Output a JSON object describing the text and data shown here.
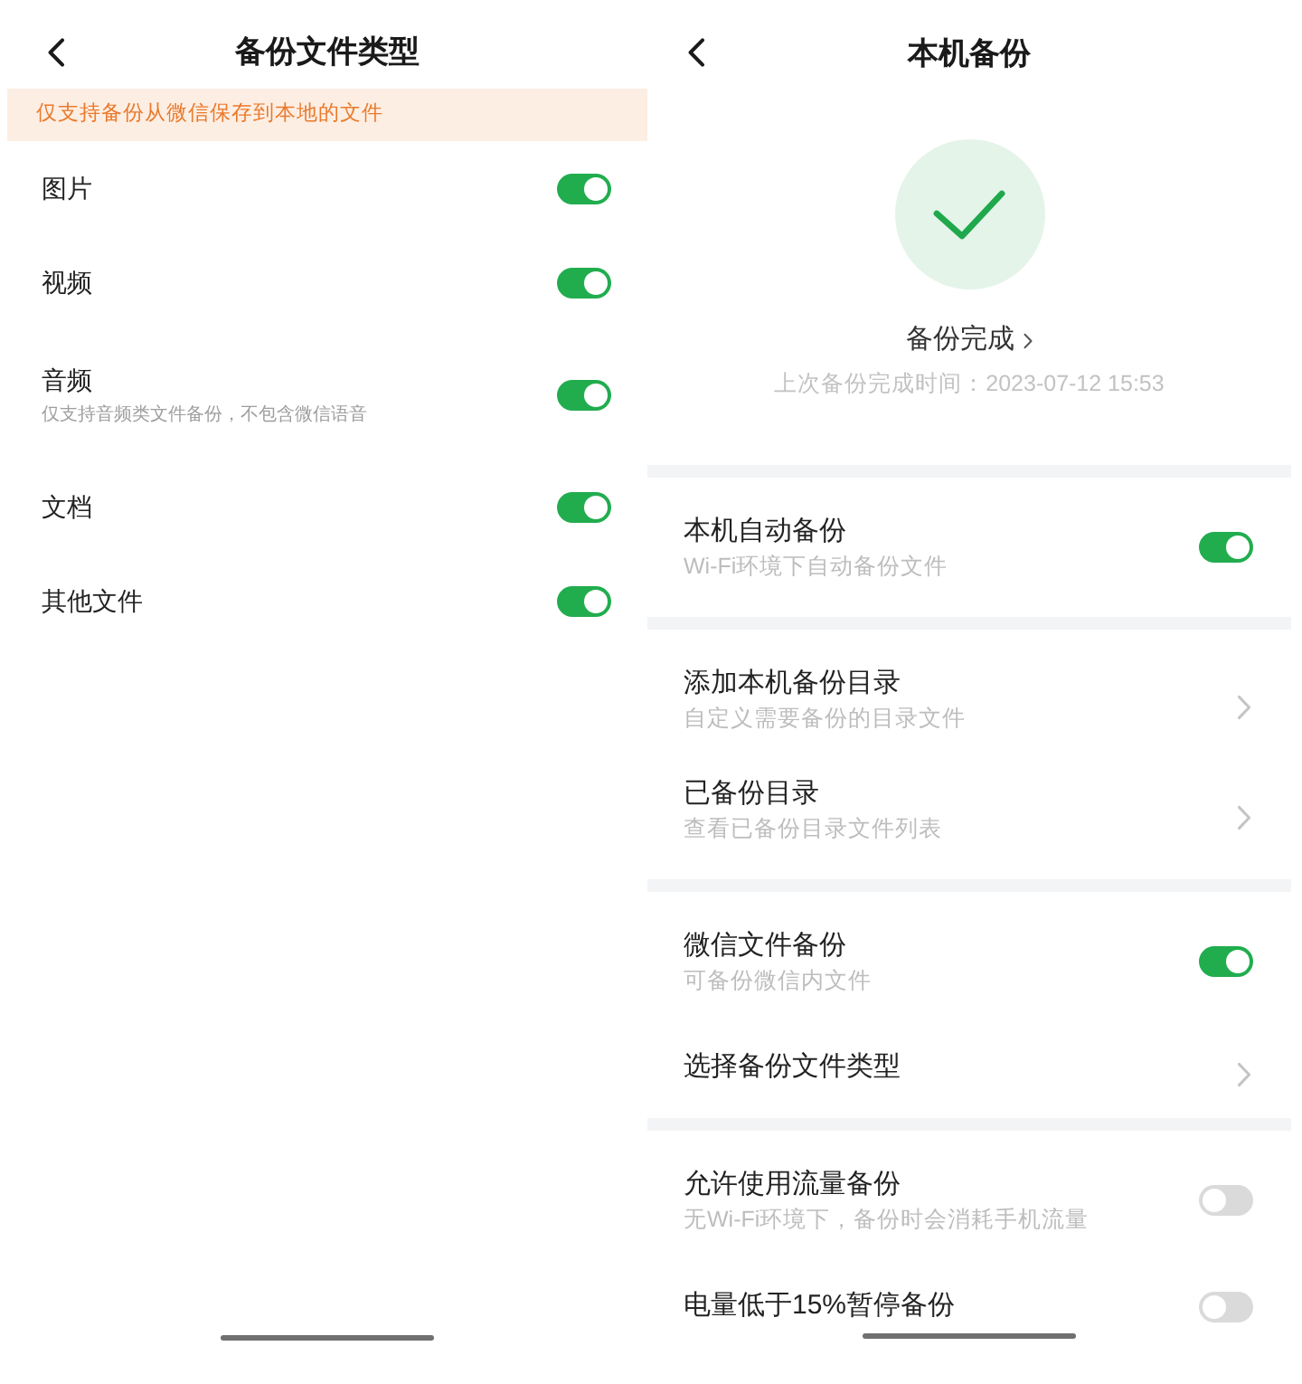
{
  "left_screen": {
    "title": "备份文件类型",
    "notice": "仅支持备份从微信保存到本地的文件",
    "items": [
      {
        "label": "图片",
        "on": true
      },
      {
        "label": "视频",
        "on": true
      },
      {
        "label": "音频",
        "description": "仅支持音频类文件备份，不包含微信语音",
        "on": true
      },
      {
        "label": "文档",
        "on": true
      },
      {
        "label": "其他文件",
        "on": true
      }
    ]
  },
  "right_screen": {
    "title": "本机备份",
    "status": {
      "label": "备份完成",
      "last_backup": "上次备份完成时间：2023-07-12 15:53"
    },
    "groups": [
      [
        {
          "kind": "toggle",
          "label": "本机自动备份",
          "description": "Wi-Fi环境下自动备份文件",
          "on": true
        }
      ],
      [
        {
          "kind": "link",
          "label": "添加本机备份目录",
          "description": "自定义需要备份的目录文件"
        },
        {
          "kind": "link",
          "label": "已备份目录",
          "description": "查看已备份目录文件列表"
        }
      ],
      [
        {
          "kind": "toggle",
          "label": "微信文件备份",
          "description": "可备份微信内文件",
          "on": true
        },
        {
          "kind": "link",
          "label": "选择备份文件类型"
        }
      ],
      [
        {
          "kind": "toggle",
          "label": "允许使用流量备份",
          "description": "无Wi-Fi环境下，备份时会消耗手机流量",
          "on": false
        },
        {
          "kind": "toggle",
          "label": "电量低于15%暂停备份",
          "on": false
        }
      ]
    ]
  }
}
